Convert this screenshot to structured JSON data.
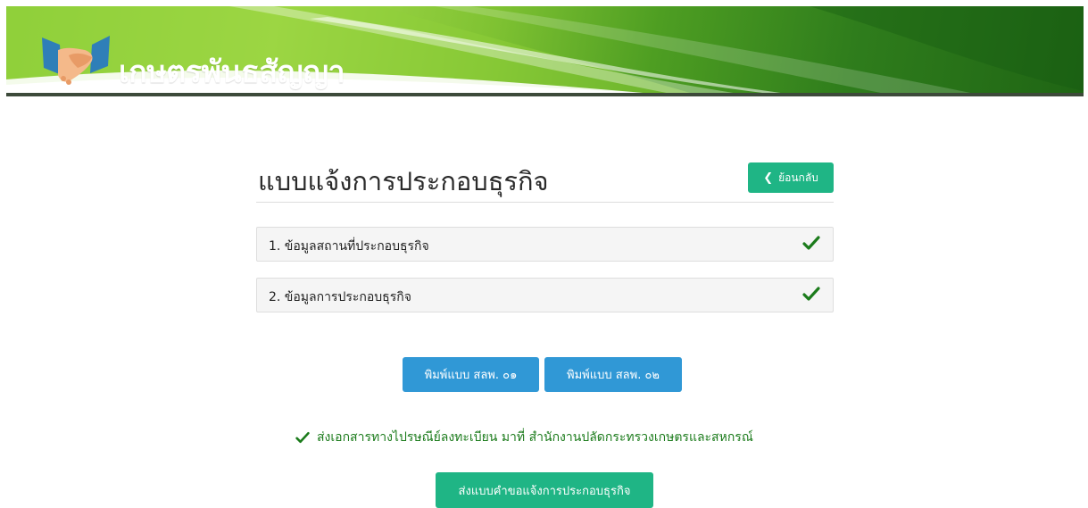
{
  "header": {
    "brand": "เกษตรพันธสัญญา",
    "logo_icon": "handshake-icon",
    "colors": {
      "banner_light": "#a8dc4c",
      "banner_dark": "#1f6514"
    }
  },
  "main": {
    "title": "แบบแจ้งการประกอบธุรกิจ",
    "back_button": {
      "label": "ย้อนกลับ",
      "icon": "chevron-left-icon"
    },
    "steps": [
      {
        "label": "1. ข้อมูลสถานที่ประกอบธุรกิจ",
        "status_icon": "check-icon"
      },
      {
        "label": "2. ข้อมูลการประกอบธุรกิจ",
        "status_icon": "check-icon"
      }
    ],
    "print_buttons": [
      {
        "label": "พิมพ์แบบ สลพ. ๐๑"
      },
      {
        "label": "พิมพ์แบบ สลพ. ๐๒"
      }
    ],
    "notice": {
      "text": "ส่งเอกสารทางไปรษณีย์ลงทะเบียน มาที่ สำนักงานปลัดกระทรวงเกษตรและสหกรณ์",
      "icon": "check-icon"
    },
    "submit_button": {
      "label": "ส่งแบบคำขอแจ้งการประกอบธุรกิจ"
    }
  },
  "colors": {
    "accent_green": "#1fb585",
    "accent_blue": "#3098d6",
    "check_green": "#1b7b1b"
  }
}
